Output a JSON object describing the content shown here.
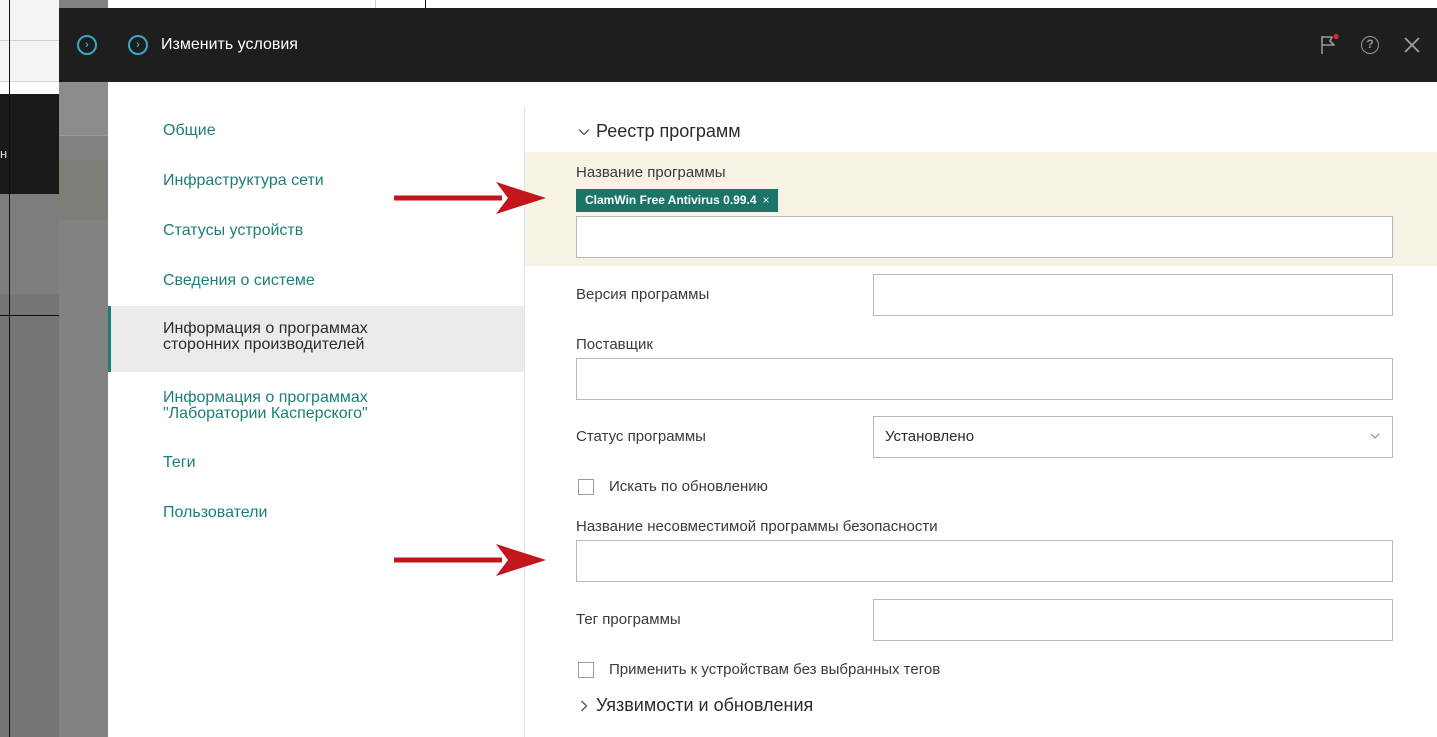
{
  "background": {
    "fragment_text": "н"
  },
  "header": {
    "title": "Изменить условия",
    "icons": {
      "outer": "chevron-circle-icon",
      "inner": "chevron-circle-icon",
      "flag": "flag-notification-icon",
      "help": "help-icon",
      "close": "close-icon"
    },
    "colors": {
      "accent": "#3aa9c5",
      "flag_dot": "#e0262c",
      "bar": "#1e1e1e"
    }
  },
  "nav": {
    "items": [
      {
        "label": "Общие"
      },
      {
        "label": "Инфраструктура сети"
      },
      {
        "label": "Статусы устройств"
      },
      {
        "label": "Сведения о системе"
      },
      {
        "label_line1": "Информация о программах",
        "label_line2": "сторонних производителей",
        "active": true
      },
      {
        "label_line1": "Информация о программах",
        "label_line2": "\"Лаборатории Касперского\""
      },
      {
        "label": "Теги"
      },
      {
        "label": "Пользователи"
      }
    ],
    "accent": "#1b7f78"
  },
  "content": {
    "registry_section": {
      "title": "Реестр программ",
      "expanded": true
    },
    "program_name": {
      "label": "Название программы",
      "chip": "ClamWin Free Antivirus 0.99.4",
      "chip_remove": "×",
      "value": ""
    },
    "program_version": {
      "label": "Версия программы",
      "value": ""
    },
    "vendor": {
      "label": "Поставщик",
      "value": ""
    },
    "program_status": {
      "label": "Статус программы",
      "selected": "Установлено"
    },
    "search_by_update": {
      "label": "Искать по обновлению",
      "checked": false
    },
    "incompatible_security": {
      "label": "Название несовместимой программы безопасности",
      "value": ""
    },
    "program_tag": {
      "label": "Тег программы",
      "value": ""
    },
    "apply_without_tags": {
      "label": "Применить к устройствам без выбранных тегов",
      "checked": false
    },
    "vuln_section": {
      "title": "Уязвимости и обновления",
      "expanded": false
    }
  },
  "annotation_color": "#c0161c"
}
